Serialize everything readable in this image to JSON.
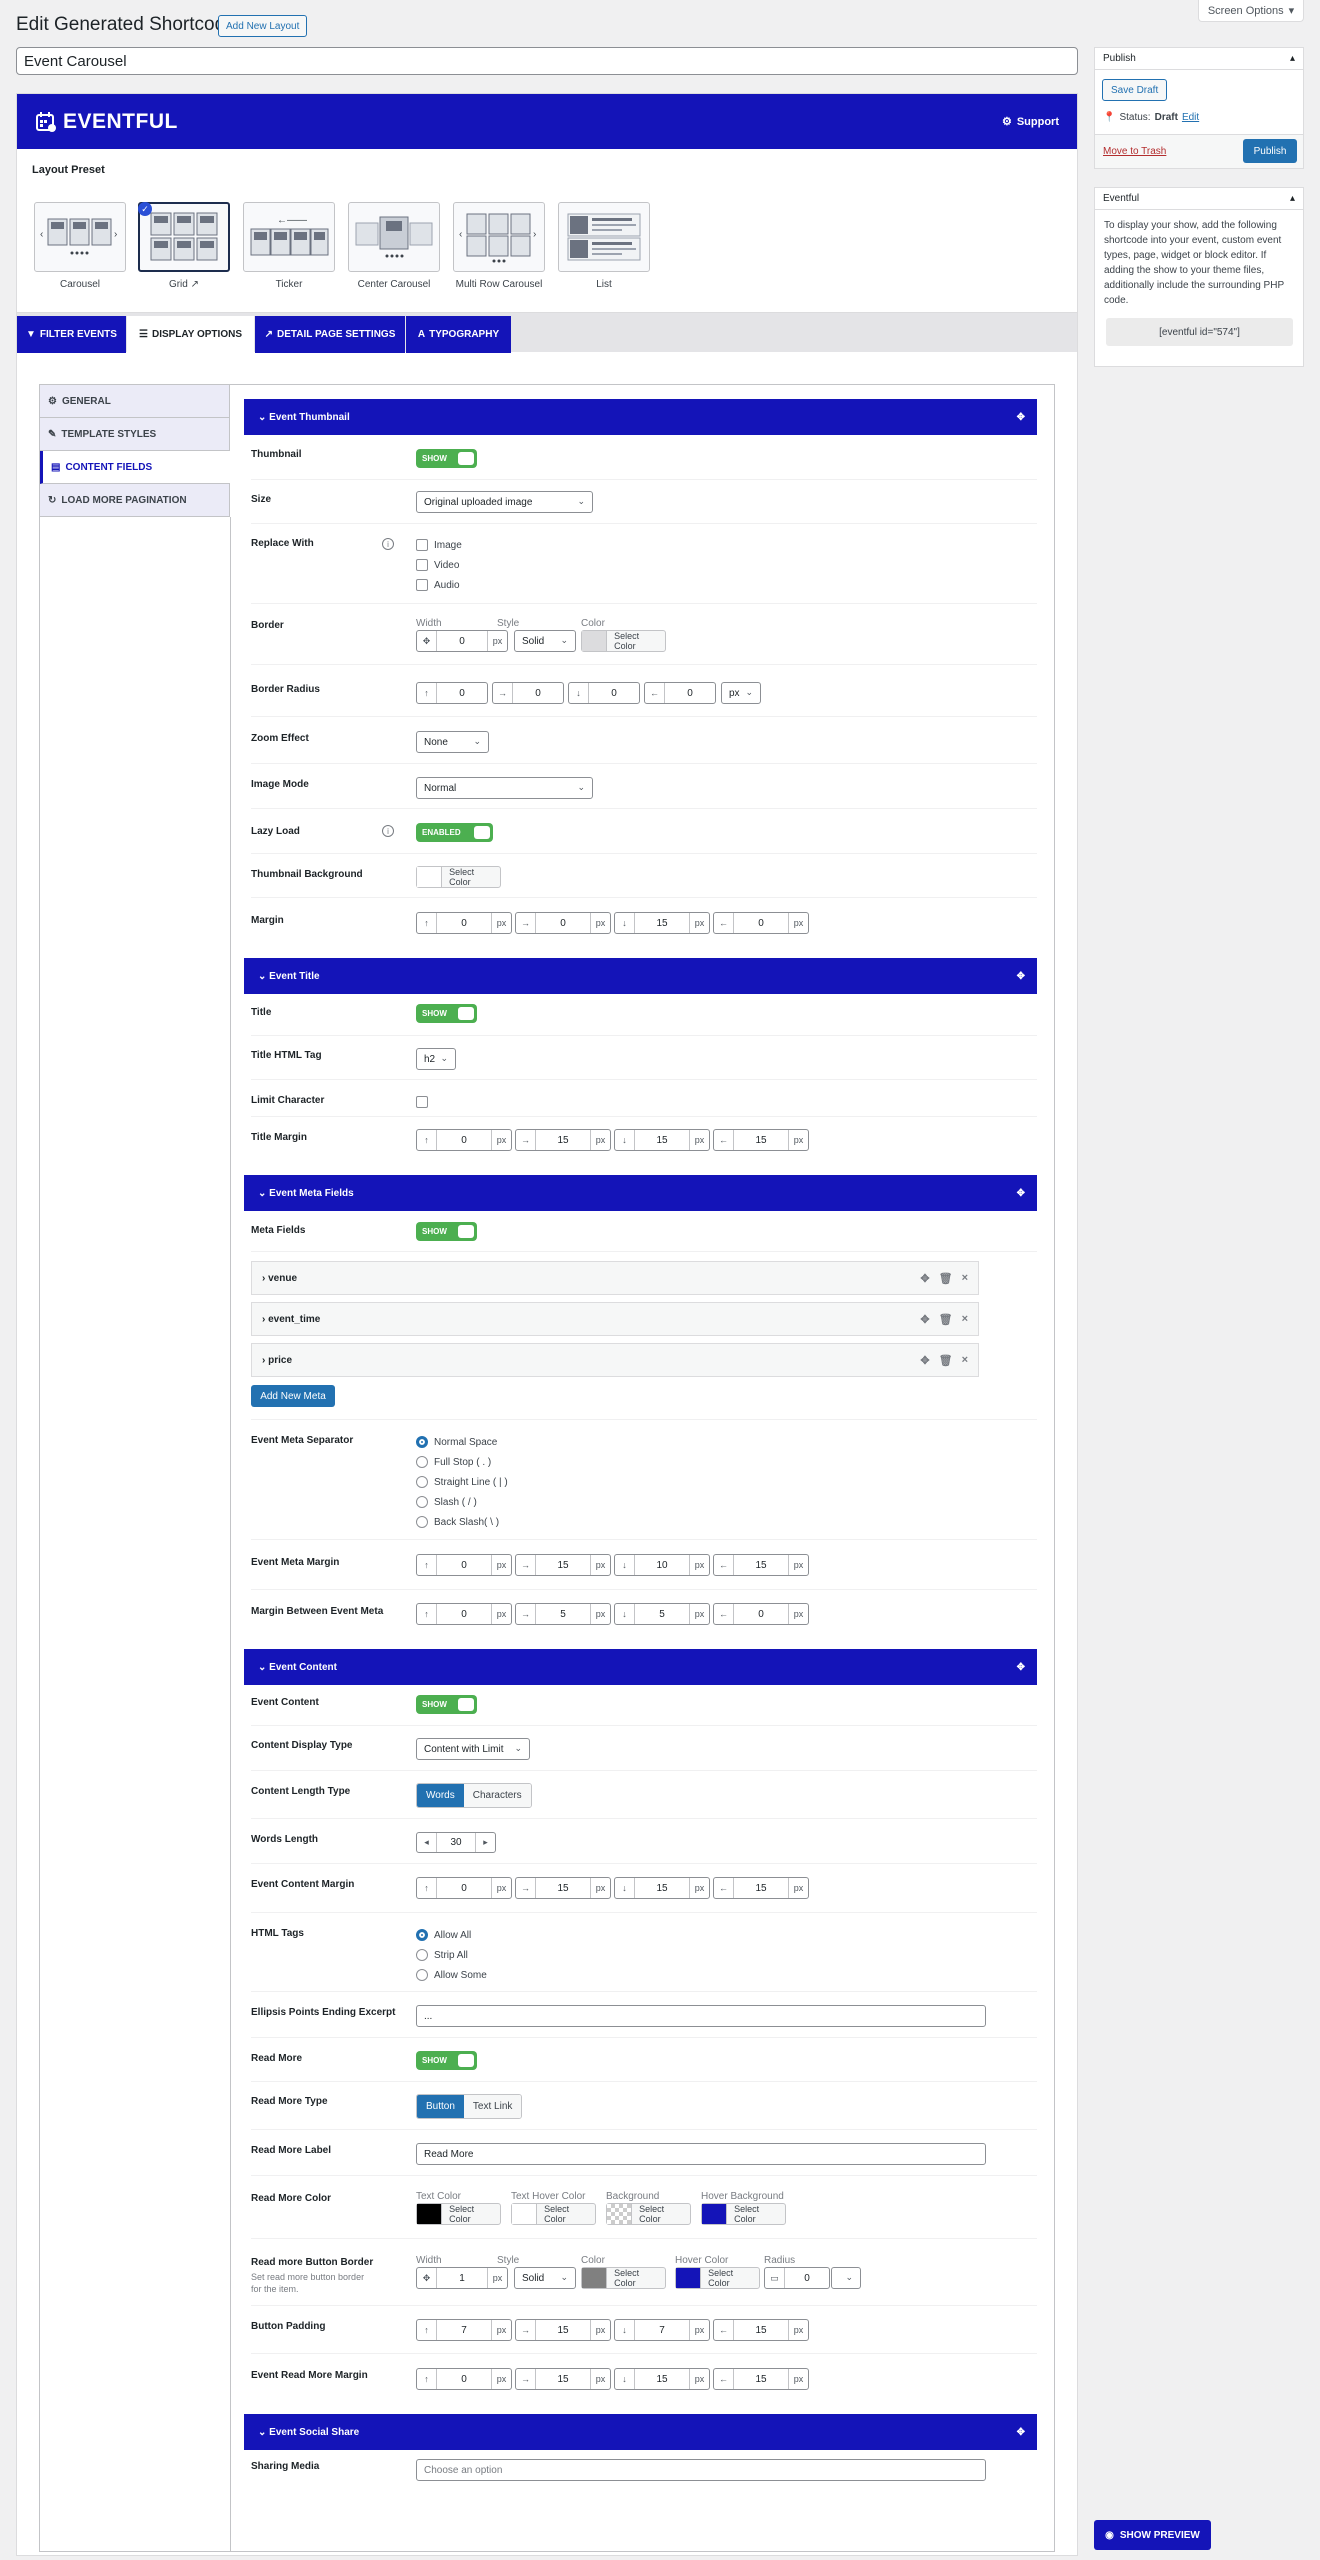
{
  "header": {
    "screen_options": "Screen Options",
    "page_title": "Edit Generated Shortcode",
    "add_new_layout": "Add New Layout",
    "post_title": "Event Carousel"
  },
  "banner": {
    "logo": "EVENTFUL",
    "support": "Support"
  },
  "layout_preset": {
    "label": "Layout Preset",
    "options": [
      "Carousel",
      "Grid",
      "Ticker",
      "Center Carousel",
      "Multi Row Carousel",
      "List"
    ],
    "selected": "Grid"
  },
  "tabs": [
    "FILTER EVENTS",
    "DISPLAY OPTIONS",
    "DETAIL PAGE SETTINGS",
    "TYPOGRAPHY"
  ],
  "active_tab": "DISPLAY OPTIONS",
  "sidebar": {
    "items": [
      "GENERAL",
      "TEMPLATE STYLES",
      "CONTENT FIELDS",
      "LOAD MORE PAGINATION"
    ],
    "active": "CONTENT FIELDS"
  },
  "sections": {
    "thumbnail": {
      "title": "Event Thumbnail",
      "thumbnail_label": "Thumbnail",
      "thumbnail_toggle": "SHOW",
      "size_label": "Size",
      "size_value": "Original uploaded image",
      "replace_label": "Replace With",
      "replace_options": [
        "Image",
        "Video",
        "Audio"
      ],
      "border_label": "Border",
      "border_width_label": "Width",
      "border_width": "0",
      "border_style_label": "Style",
      "border_style": "Solid",
      "border_color_label": "Color",
      "select_color": "Select Color",
      "radius_label": "Border Radius",
      "radius_values": [
        "0",
        "0",
        "0",
        "0"
      ],
      "radius_unit": "px",
      "zoom_label": "Zoom Effect",
      "zoom_value": "None",
      "image_mode_label": "Image Mode",
      "image_mode_value": "Normal",
      "lazy_label": "Lazy Load",
      "lazy_toggle": "ENABLED",
      "bg_label": "Thumbnail Background",
      "margin_label": "Margin",
      "margin_values": [
        "0",
        "0",
        "15",
        "0"
      ]
    },
    "title": {
      "title": "Event Title",
      "title_label": "Title",
      "title_toggle": "SHOW",
      "tag_label": "Title HTML Tag",
      "tag_value": "h2",
      "limit_label": "Limit Character",
      "margin_label": "Title Margin",
      "margin_values": [
        "0",
        "15",
        "15",
        "15"
      ]
    },
    "meta": {
      "title": "Event Meta Fields",
      "meta_label": "Meta Fields",
      "meta_toggle": "SHOW",
      "items": [
        "venue",
        "event_time",
        "price"
      ],
      "add_button": "Add New Meta",
      "separator_label": "Event Meta Separator",
      "separator_options": [
        "Normal Space",
        "Full Stop ( . )",
        "Straight Line ( | )",
        "Slash ( / )",
        "Back Slash( \\ )"
      ],
      "margin_label": "Event Meta Margin",
      "margin_values": [
        "0",
        "15",
        "10",
        "15"
      ],
      "between_label": "Margin Between Event Meta",
      "between_values": [
        "0",
        "5",
        "5",
        "0"
      ]
    },
    "content": {
      "title": "Event Content",
      "content_label": "Event Content",
      "content_toggle": "SHOW",
      "display_type_label": "Content Display Type",
      "display_type_value": "Content with Limit",
      "length_type_label": "Content Length Type",
      "length_type_options": [
        "Words",
        "Characters"
      ],
      "words_length_label": "Words Length",
      "words_length": "30",
      "content_margin_label": "Event Content Margin",
      "content_margin_values": [
        "0",
        "15",
        "15",
        "15"
      ],
      "html_tags_label": "HTML Tags",
      "html_tags_options": [
        "Allow All",
        "Strip All",
        "Allow Some"
      ],
      "ellipsis_label": "Ellipsis Points Ending Excerpt",
      "ellipsis_value": "...",
      "read_more_label": "Read More",
      "read_more_toggle": "SHOW",
      "read_more_type_label": "Read More Type",
      "read_more_type_options": [
        "Button",
        "Text Link"
      ],
      "read_more_text_label": "Read More Label",
      "read_more_text_value": "Read More",
      "read_more_color_label": "Read More Color",
      "color_sublabels": [
        "Text Color",
        "Text Hover Color",
        "Background",
        "Hover Background"
      ],
      "button_border_label": "Read more Button Border",
      "button_border_help": "Set read more button border for the item.",
      "button_border_sublabels": [
        "Width",
        "Style",
        "Color",
        "Hover Color",
        "Radius"
      ],
      "button_border_width": "1",
      "button_border_style": "Solid",
      "button_border_radius": "0",
      "button_padding_label": "Button Padding",
      "button_padding_values": [
        "7",
        "15",
        "7",
        "15"
      ],
      "read_more_margin_label": "Event Read More Margin",
      "read_more_margin_values": [
        "0",
        "15",
        "15",
        "15"
      ]
    },
    "social": {
      "title": "Event Social Share",
      "sharing_label": "Sharing Media",
      "sharing_placeholder": "Choose an option"
    }
  },
  "publish_box": {
    "title": "Publish",
    "save_draft": "Save Draft",
    "status_label": "Status:",
    "status_value": "Draft",
    "edit_link": "Edit",
    "trash": "Move to Trash",
    "publish": "Publish"
  },
  "eventful_box": {
    "title": "Eventful",
    "description": "To display your show, add the following shortcode into your event, custom event types, page, widget or block editor. If adding the show to your theme files, additionally include the surrounding PHP code.",
    "shortcode": "[eventful id=\"574\"]"
  },
  "show_preview": "SHOW PREVIEW",
  "colors": {
    "brand_blue": "#1414b8",
    "wp_blue": "#2271b1",
    "toggle_green": "#4caf50",
    "text_color": "#000000",
    "text_hover_color": "#ffffff",
    "hover_background": "#1414b8",
    "border_color": "#808080",
    "border_hover_color": "#1414b8"
  }
}
